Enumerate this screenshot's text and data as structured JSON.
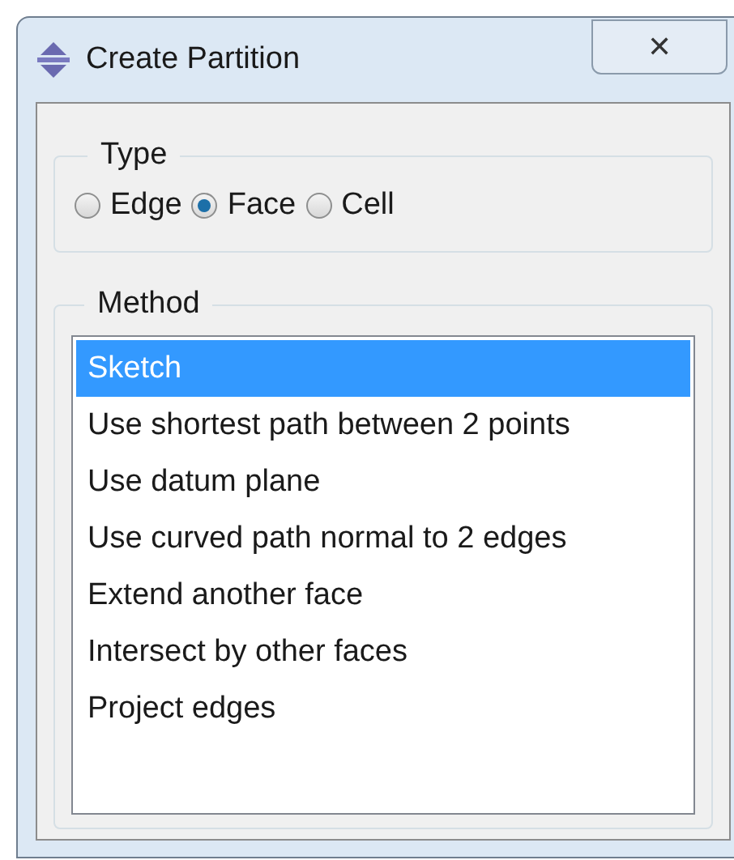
{
  "window": {
    "title": "Create Partition",
    "close": "✕"
  },
  "type_group": {
    "label": "Type",
    "options": [
      {
        "label": "Edge",
        "selected": false
      },
      {
        "label": "Face",
        "selected": true
      },
      {
        "label": "Cell",
        "selected": false
      }
    ]
  },
  "method_group": {
    "label": "Method",
    "items": [
      {
        "label": "Sketch",
        "selected": true
      },
      {
        "label": "Use shortest path between 2 points",
        "selected": false
      },
      {
        "label": "Use datum plane",
        "selected": false
      },
      {
        "label": "Use curved path normal to 2 edges",
        "selected": false
      },
      {
        "label": "Extend another face",
        "selected": false
      },
      {
        "label": "Intersect by other faces",
        "selected": false
      },
      {
        "label": "Project edges",
        "selected": false
      }
    ]
  }
}
